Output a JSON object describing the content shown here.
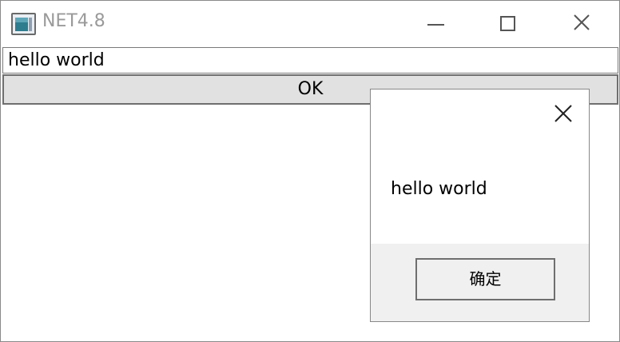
{
  "window": {
    "title": "NET4.8",
    "icon": "window-app-icon",
    "controls": {
      "minimize_icon": "minimize-icon",
      "maximize_icon": "maximize-icon",
      "close_icon": "close-icon"
    }
  },
  "main": {
    "textbox_value": "hello world",
    "ok_button_label": "OK"
  },
  "messagebox": {
    "close_icon": "close-icon",
    "message": "hello world",
    "confirm_label": "确定"
  },
  "colors": {
    "title_text": "#9a9a9a",
    "button_face": "#e1e1e1",
    "dialog_footer": "#f0f0f0"
  }
}
